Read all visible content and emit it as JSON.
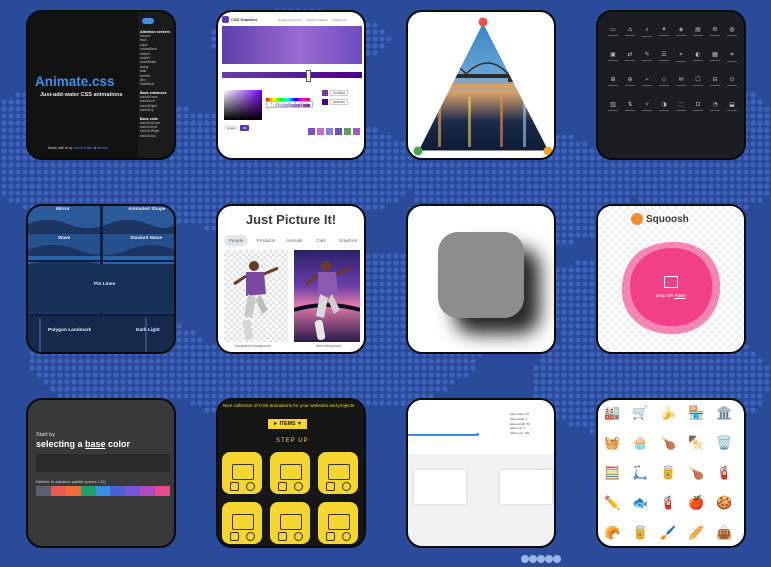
{
  "page": {
    "background": "#2a4a9a",
    "dot_color": "#3d63bd"
  },
  "cards": {
    "animate": {
      "title": "Animate.css",
      "subtitle": "Just-add-water CSS animations",
      "footer_a": "Made with ♥ by",
      "footer_b": "Daniel Eden",
      "footer_c": "&",
      "footer_d": "friends",
      "accent": "#3d8ff0",
      "menu": [
        {
          "heading": "Attention seekers",
          "items": [
            "bounce",
            "flash",
            "pulse",
            "rubberBand",
            "shakeX",
            "shakeY",
            "headShake",
            "swing",
            "tada",
            "wobble",
            "jello",
            "heartBeat"
          ]
        },
        {
          "heading": "Back entrances",
          "items": [
            "backInDown",
            "backInLeft",
            "backInRight",
            "backInUp"
          ]
        },
        {
          "heading": "Back exits",
          "items": [
            "backOutDown",
            "backOutLeft",
            "backOutRight",
            "backOutUp"
          ]
        }
      ]
    },
    "gradient": {
      "brand": "CSS Gradient",
      "nav": [
        "Gradient Generator",
        "Gradient Palettes",
        "Gradient Art"
      ],
      "colors": [
        "#7b4fc9",
        "#c86bcf",
        "#8e7de8",
        "#6b52b8",
        "#5e9e6a",
        "#9e5bb8"
      ],
      "hex_a": "#7038A8",
      "hex_b": "#4B0082",
      "angle": "90",
      "mode": "Linear",
      "fields": [
        "R",
        "G",
        "B",
        "A"
      ]
    },
    "triangle": {
      "vertex_colors": [
        "#e8524b",
        "#f2a429",
        "#44a64f"
      ]
    },
    "icons_dark": {
      "rows": 4,
      "cols": 8
    },
    "wave": {
      "labels": [
        "Mirror",
        "Animated Shape",
        "Wave",
        "Stacked Wave",
        "Pin Lines",
        "Polygon Landmark",
        "Dark Light"
      ]
    },
    "picture": {
      "title": "Just Picture It!",
      "tabs": [
        "People",
        "Products",
        "Animals",
        "Cars",
        "Graphics"
      ],
      "caption_left": "Transparent background",
      "caption_right": "New background"
    },
    "shadow": {
      "box_color": "#8d8d8d"
    },
    "squoosh": {
      "logo": "Squoosh",
      "drop_a": "Drop OR",
      "drop_b": "Paste",
      "blob_color": "#f0287a"
    },
    "base_color": {
      "line1": "Start by",
      "line2_pre": "selecting a ",
      "line2_bold": "base",
      "line2_post": " color",
      "hint": "Default: to advance palette (colors / 12)",
      "swatches": [
        "#5b6070",
        "#e85b4e",
        "#f06d3a",
        "#22a06b",
        "#3b8fe0",
        "#4a60db",
        "#7a55d8",
        "#b048c0",
        "#e84a8e"
      ]
    },
    "css_gen": {
      "tagline": "Nice collection of CSS animations for your websites and projects",
      "dropdown": "► ITEMS ▼",
      "step": "STEP UP",
      "accent": "#f5d630"
    },
    "slider": {
      "readouts": [
        "slider-value: 10",
        "slider-width: 1",
        "slider-length: 56",
        "slider-min: 0",
        "slider-max: 100"
      ]
    },
    "objects": {
      "icons": [
        "🏭",
        "🛒",
        "🍌",
        "🏪",
        "🏛️",
        "🧺",
        "🧁",
        "🍗",
        "🍢",
        "🗑️",
        "🧮",
        "🛴",
        "🥫",
        "🍗",
        "🧯",
        "✏️",
        "🐟",
        "🧯",
        "🍎",
        "🍪",
        "🥐",
        "🥫",
        "🖌️",
        "🥖",
        "👜"
      ]
    }
  }
}
